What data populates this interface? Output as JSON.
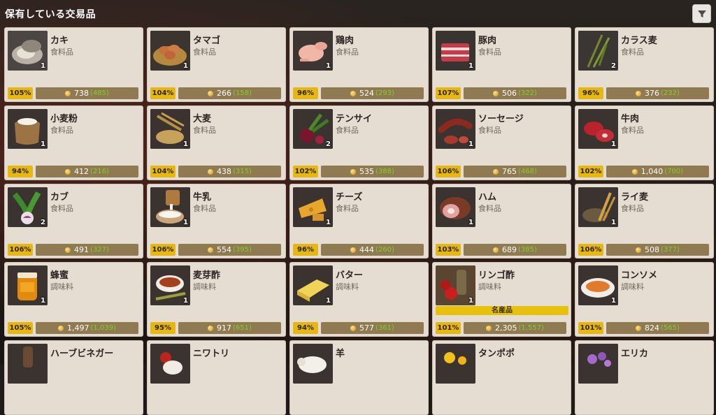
{
  "header": {
    "title": "保有している交易品"
  },
  "items": [
    {
      "name": "カキ",
      "category": "食料品",
      "qty": "1",
      "percent": "105%",
      "price": "738",
      "sub": "(485)",
      "icon": "oyster-icon"
    },
    {
      "name": "タマゴ",
      "category": "食料品",
      "qty": "1",
      "percent": "104%",
      "price": "266",
      "sub": "(158)",
      "icon": "eggs-icon"
    },
    {
      "name": "鶏肉",
      "category": "食料品",
      "qty": "1",
      "percent": "96%",
      "price": "524",
      "sub": "(293)",
      "icon": "chicken-meat-icon"
    },
    {
      "name": "豚肉",
      "category": "食料品",
      "qty": "1",
      "percent": "107%",
      "price": "506",
      "sub": "(322)",
      "icon": "pork-icon"
    },
    {
      "name": "カラス麦",
      "category": "食料品",
      "qty": "2",
      "percent": "96%",
      "price": "376",
      "sub": "(232)",
      "icon": "oats-icon"
    },
    {
      "name": "小麦粉",
      "category": "食料品",
      "qty": "1",
      "percent": "94%",
      "price": "412",
      "sub": "(216)",
      "icon": "flour-icon"
    },
    {
      "name": "大麦",
      "category": "食料品",
      "qty": "1",
      "percent": "104%",
      "price": "438",
      "sub": "(315)",
      "icon": "barley-icon"
    },
    {
      "name": "テンサイ",
      "category": "食料品",
      "qty": "2",
      "percent": "102%",
      "price": "535",
      "sub": "(388)",
      "icon": "beet-icon"
    },
    {
      "name": "ソーセージ",
      "category": "食料品",
      "qty": "1",
      "percent": "106%",
      "price": "765",
      "sub": "(468)",
      "icon": "sausage-icon"
    },
    {
      "name": "牛肉",
      "category": "食料品",
      "qty": "1",
      "percent": "102%",
      "price": "1,040",
      "sub": "(700)",
      "icon": "beef-icon"
    },
    {
      "name": "カブ",
      "category": "食料品",
      "qty": "2",
      "percent": "106%",
      "price": "491",
      "sub": "(327)",
      "icon": "turnip-icon"
    },
    {
      "name": "牛乳",
      "category": "食料品",
      "qty": "1",
      "percent": "106%",
      "price": "554",
      "sub": "(395)",
      "icon": "milk-icon"
    },
    {
      "name": "チーズ",
      "category": "食料品",
      "qty": "1",
      "percent": "96%",
      "price": "444",
      "sub": "(260)",
      "icon": "cheese-icon"
    },
    {
      "name": "ハム",
      "category": "食料品",
      "qty": "1",
      "percent": "103%",
      "price": "689",
      "sub": "(385)",
      "icon": "ham-icon"
    },
    {
      "name": "ライ麦",
      "category": "食料品",
      "qty": "1",
      "percent": "106%",
      "price": "508",
      "sub": "(377)",
      "icon": "rye-icon"
    },
    {
      "name": "蜂蜜",
      "category": "調味料",
      "qty": "1",
      "percent": "105%",
      "price": "1,497",
      "sub": "(1,039)",
      "icon": "honey-icon"
    },
    {
      "name": "麦芽酢",
      "category": "調味料",
      "qty": "1",
      "percent": "95%",
      "price": "917",
      "sub": "(651)",
      "icon": "malt-vinegar-icon"
    },
    {
      "name": "バター",
      "category": "調味料",
      "qty": "1",
      "percent": "94%",
      "price": "577",
      "sub": "(361)",
      "icon": "butter-icon"
    },
    {
      "name": "リンゴ酢",
      "category": "調味料",
      "qty": "1",
      "percent": "101%",
      "price": "2,305",
      "sub": "(1,557)",
      "icon": "apple-vinegar-icon",
      "special": "名産品"
    },
    {
      "name": "コンソメ",
      "category": "調味料",
      "qty": "1",
      "percent": "101%",
      "price": "824",
      "sub": "(565)",
      "icon": "consomme-icon"
    },
    {
      "name": "ハーブビネガー",
      "category": "",
      "qty": "",
      "percent": "",
      "price": "",
      "sub": "",
      "icon": "herb-vinegar-icon"
    },
    {
      "name": "ニワトリ",
      "category": "",
      "qty": "",
      "percent": "",
      "price": "",
      "sub": "",
      "icon": "rooster-icon"
    },
    {
      "name": "羊",
      "category": "",
      "qty": "",
      "percent": "",
      "price": "",
      "sub": "",
      "icon": "sheep-icon"
    },
    {
      "name": "タンポポ",
      "category": "",
      "qty": "",
      "percent": "",
      "price": "",
      "sub": "",
      "icon": "dandelion-icon"
    },
    {
      "name": "エリカ",
      "category": "",
      "qty": "",
      "percent": "",
      "price": "",
      "sub": "",
      "icon": "heather-icon"
    }
  ],
  "colors": {
    "card_bg": "#e6ddd2",
    "percent_badge": "#e6b70f",
    "price_bar": "#8f7a52",
    "sub_price": "#7ed321",
    "special_badge": "#e7c10c"
  }
}
